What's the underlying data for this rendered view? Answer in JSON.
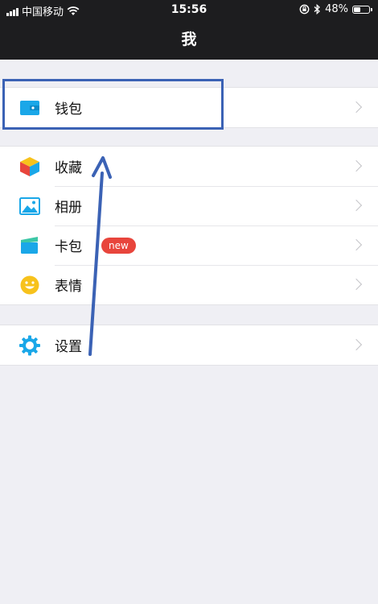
{
  "status_bar": {
    "carrier": "中国移动",
    "time": "15:56",
    "battery_percent": "48%",
    "battery_level": 0.48
  },
  "nav": {
    "title": "我"
  },
  "menu": {
    "wallet": {
      "label": "钱包",
      "icon": "wallet-icon"
    },
    "favorites": {
      "label": "收藏",
      "icon": "favorites-cube-icon"
    },
    "album": {
      "label": "相册",
      "icon": "album-picture-icon"
    },
    "card_pack": {
      "label": "卡包",
      "icon": "card-pack-icon",
      "badge": "new"
    },
    "stickers": {
      "label": "表情",
      "icon": "smiley-icon"
    },
    "settings": {
      "label": "设置",
      "icon": "gear-icon"
    }
  },
  "colors": {
    "header_bg": "#1d1d1f",
    "page_bg": "#efeff4",
    "badge_red": "#e8453c",
    "annotation_blue": "#3b62b5",
    "icon_blue": "#1aa7e8",
    "icon_yellow": "#f7c21c",
    "icon_green": "#3cc7a6"
  }
}
